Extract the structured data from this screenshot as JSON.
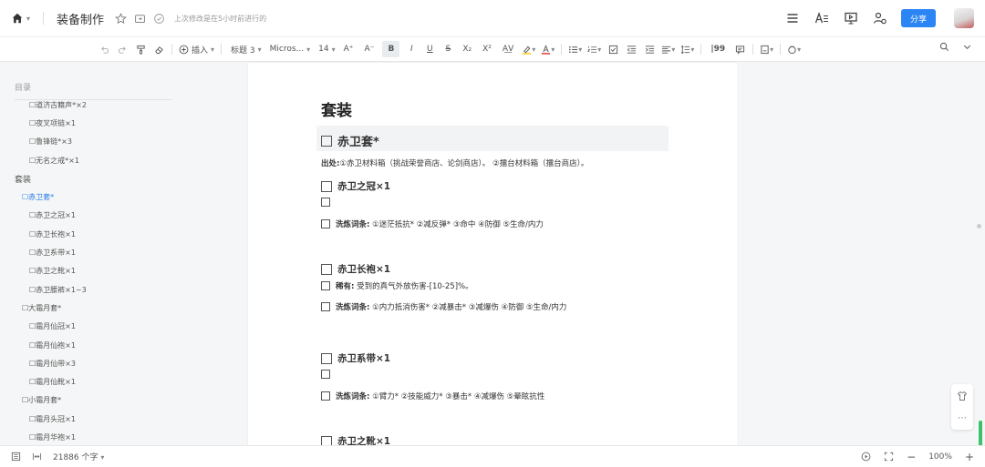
{
  "header": {
    "title": "装备制作",
    "save_status": "上次修改是在5小时前进行的",
    "share_label": "分享"
  },
  "toolbar": {
    "insert_label": "插入",
    "heading_label": "标题 3",
    "font_label": "Micros...",
    "size_label": "14"
  },
  "sidebar": {
    "header": "目录",
    "items": [
      {
        "label": "☐道济古籍声*×2",
        "level": 3
      },
      {
        "label": "☐夜叉项链×1",
        "level": 3
      },
      {
        "label": "☐鲁锋链*×3",
        "level": 3
      },
      {
        "label": "☐无名之戒*×1",
        "level": 3
      },
      {
        "label": "套装",
        "level": 1
      },
      {
        "label": "☐赤卫套*",
        "level": 2,
        "active": true
      },
      {
        "label": "☐赤卫之冠×1",
        "level": 3
      },
      {
        "label": "☐赤卫长袍×1",
        "level": 3
      },
      {
        "label": "☐赤卫系带×1",
        "level": 3
      },
      {
        "label": "☐赤卫之靴×1",
        "level": 3
      },
      {
        "label": "☐赤卫腰裤×1~3",
        "level": 3
      },
      {
        "label": "☐大霜月套*",
        "level": 2
      },
      {
        "label": "☐霜月仙冠×1",
        "level": 3
      },
      {
        "label": "☐霜月仙袍×1",
        "level": 3
      },
      {
        "label": "☐霜月仙带×3",
        "level": 3
      },
      {
        "label": "☐霜月仙靴×1",
        "level": 3
      },
      {
        "label": "☐小霜月套*",
        "level": 2
      },
      {
        "label": "☐霜月头冠×1",
        "level": 3
      },
      {
        "label": "☐霜月华袍×1",
        "level": 3
      }
    ]
  },
  "document": {
    "h1": "套装",
    "h2": "赤卫套*",
    "source_label": "出处:",
    "source_text": "①赤卫材料箱（挑战荣誉商店、论剑商店）。 ②擂台材料箱（擂台商店）。",
    "blocks": [
      {
        "title": "赤卫之冠×1",
        "lines": [
          {
            "label": "",
            "text": ""
          },
          {
            "label": "洗炼词条:",
            "text": "①迷茫抵抗* ②减反弹* ③命中 ④防御 ⑤生命/内力"
          }
        ]
      },
      {
        "title": "赤卫长袍×1",
        "lines": [
          {
            "label": "稀有:",
            "text": "受到的真气外放伤害-[10-25]%。"
          },
          {
            "label": "洗炼词条:",
            "text": "①内力抵消伤害* ②减暴击* ③减爆伤 ④防御 ⑤生命/内力"
          }
        ]
      },
      {
        "title": "赤卫系带×1",
        "lines": [
          {
            "label": "",
            "text": ""
          },
          {
            "label": "洗炼词条:",
            "text": "①臂力* ②技能威力* ③暴击* ④减爆伤 ⑤晕眩抗性"
          }
        ]
      },
      {
        "title": "赤卫之靴×1",
        "lines": []
      }
    ]
  },
  "statusbar": {
    "word_count": "21886 个字",
    "zoom": "100%"
  },
  "colors": {
    "accent": "#2b85f5",
    "active_toc": "#2b7de9",
    "scroll_indicator": "#3bc26a"
  }
}
